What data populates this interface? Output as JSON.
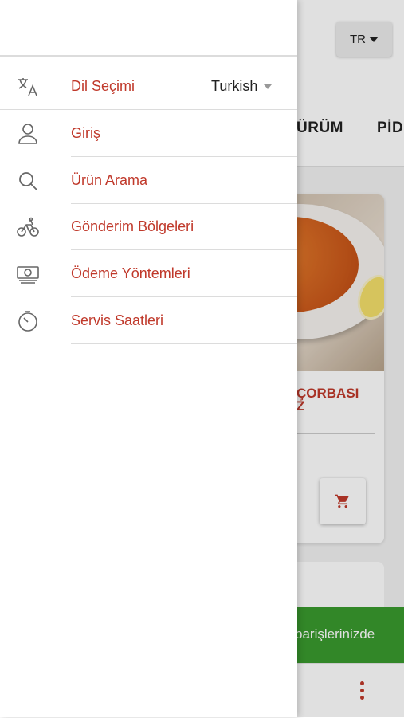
{
  "background": {
    "lang_button": "TR",
    "categories": [
      "ÜRÜM",
      "PİD"
    ],
    "product_title": "ÇORBASI\nZ",
    "banner_text": "parişlerinizde"
  },
  "drawer": {
    "items": [
      {
        "label": "Dil Seçimi",
        "icon": "translate-icon",
        "value": "Turkish"
      },
      {
        "label": "Giriş",
        "icon": "person-icon"
      },
      {
        "label": "Ürün Arama",
        "icon": "search-icon"
      },
      {
        "label": "Gönderim Bölgeleri",
        "icon": "bicycle-icon"
      },
      {
        "label": "Ödeme Yöntemleri",
        "icon": "money-icon"
      },
      {
        "label": "Servis Saatleri",
        "icon": "timer-icon"
      }
    ]
  },
  "colors": {
    "accent": "#c0392b",
    "banner": "#3a9a2e"
  }
}
